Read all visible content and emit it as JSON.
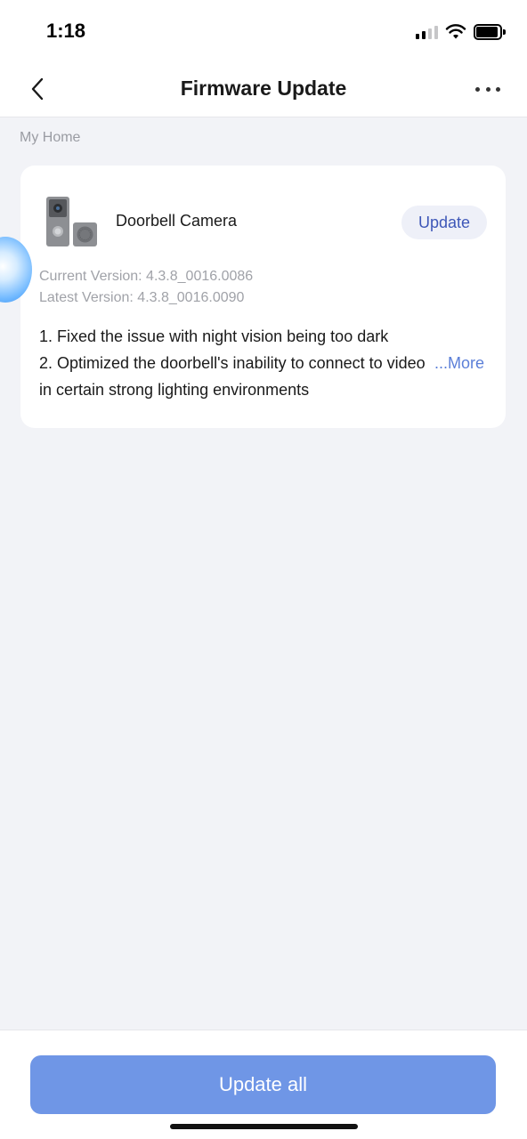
{
  "status_bar": {
    "time": "1:18"
  },
  "header": {
    "title": "Firmware Update"
  },
  "section": {
    "label": "My Home"
  },
  "device": {
    "name": "Doorbell Camera",
    "update_label": "Update",
    "current_version": "Current Version: 4.3.8_0016.0086",
    "latest_version": "Latest Version: 4.3.8_0016.0090",
    "notes": [
      "1. Fixed the issue with night vision being too dark",
      "2. Optimized the doorbell's inability to connect to video in certain strong lighting environments"
    ],
    "more_label": "...More"
  },
  "footer": {
    "update_all_label": "Update all"
  },
  "icons": {
    "back": "chevron-left-icon",
    "more": "more-dots-icon",
    "signal": "signal-icon",
    "wifi": "wifi-icon",
    "battery": "battery-icon",
    "device": "doorbell-camera-icon",
    "assistant": "assistant-bubble-icon"
  },
  "colors": {
    "accent": "#6f96e6",
    "link": "#5b7fd8",
    "update_button_text": "#3e57b8",
    "update_button_bg": "#eef0f8",
    "background": "#f2f3f7"
  }
}
